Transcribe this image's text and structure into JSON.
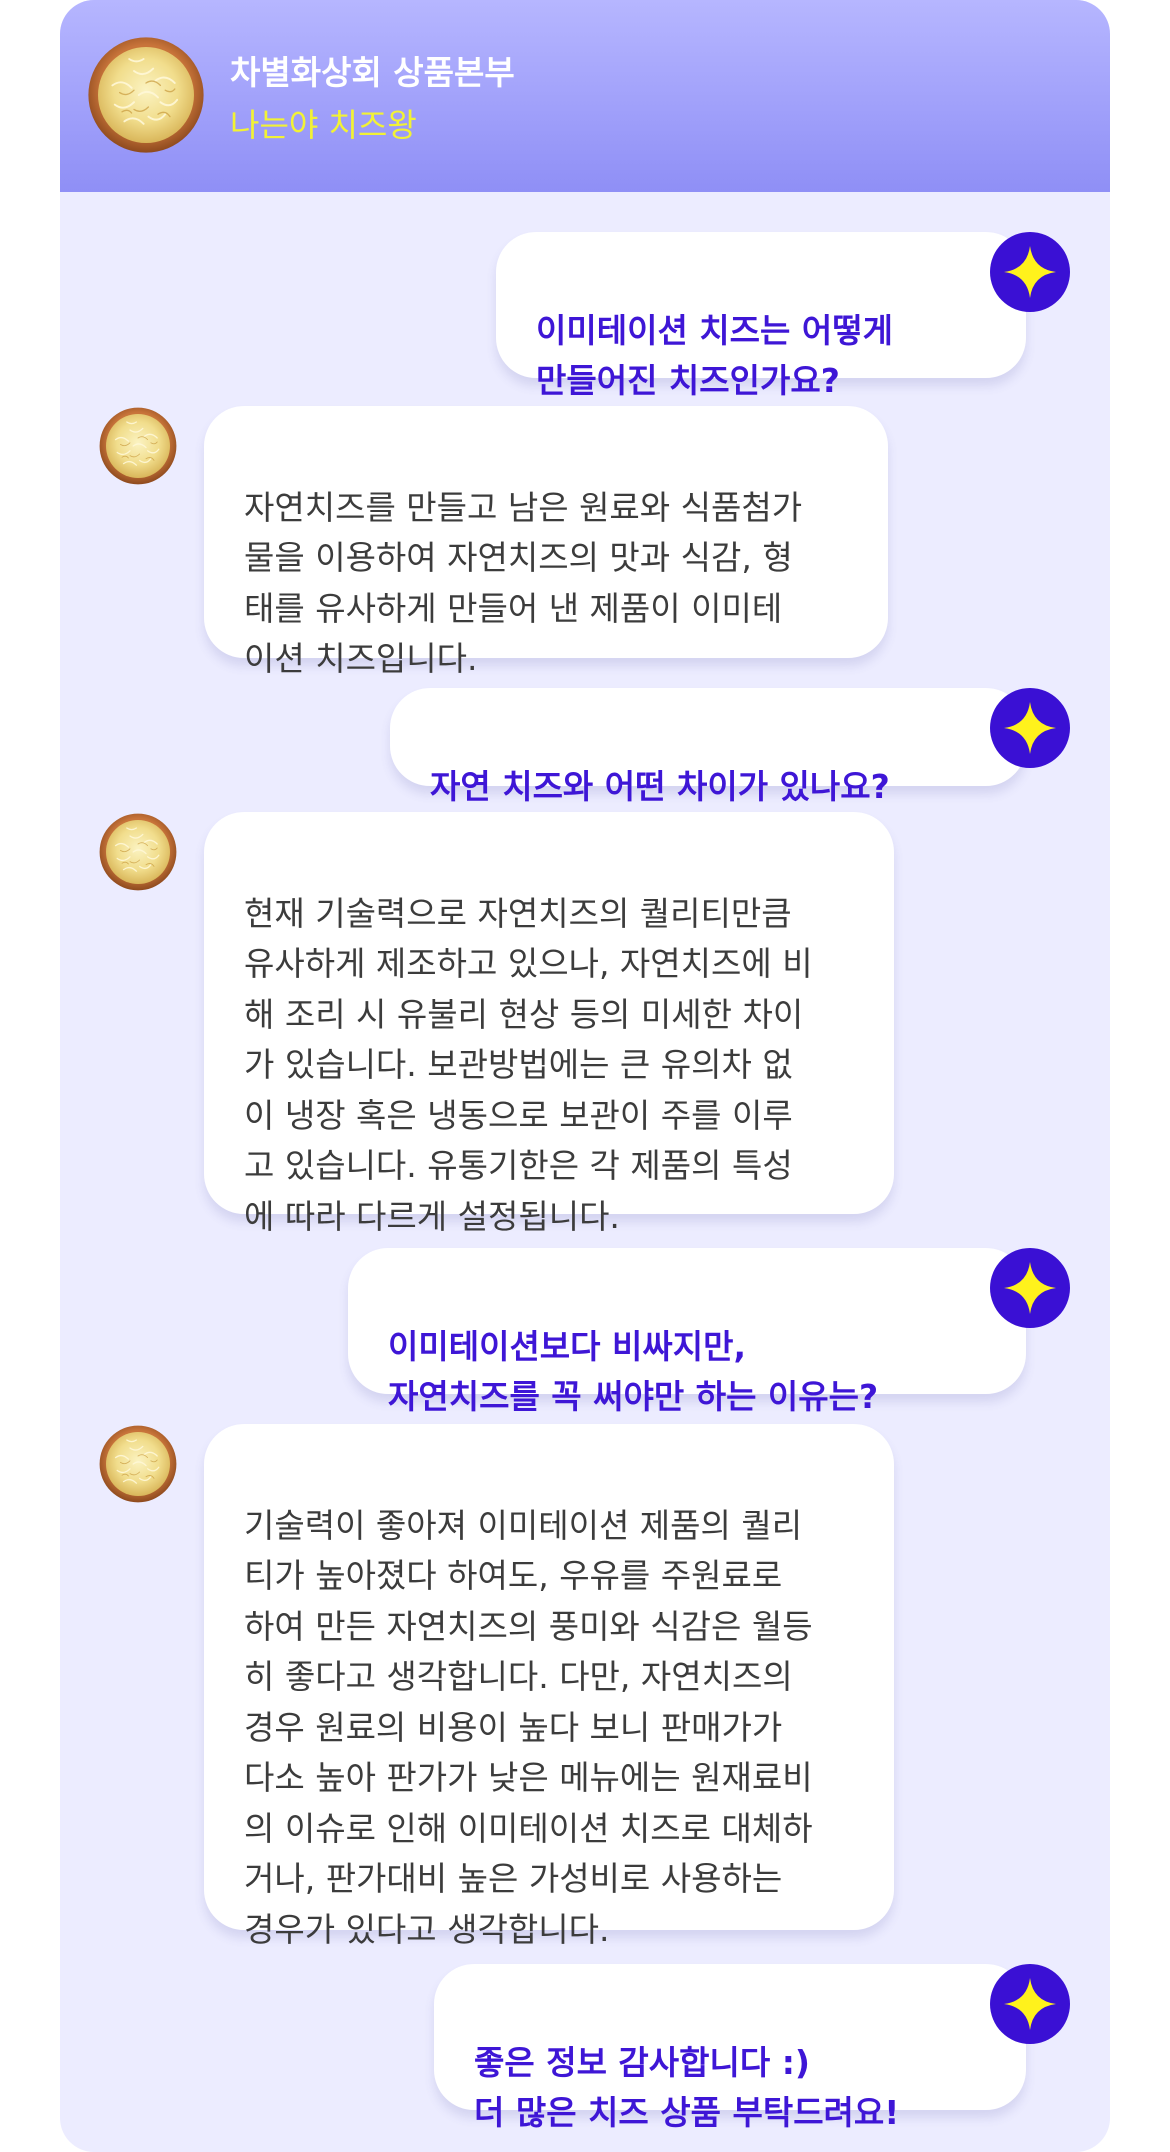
{
  "header": {
    "title": "차별화상회 상품본부",
    "subtitle": "나는야 치즈왕",
    "avatar_icon": "shredded-cheese-bowl-icon"
  },
  "colors": {
    "header_gradient_top": "#b6b6ff",
    "header_gradient_bottom": "#8f8ff6",
    "chat_background": "#ececff",
    "user_text": "#3e16d6",
    "bot_text": "#3c3c3c",
    "subtitle_text": "#f2f235",
    "star_avatar_bg": "#3a10d4",
    "star_color": "#fff21c"
  },
  "messages": [
    {
      "sender": "user",
      "avatar_icon": "sparkle-star-icon",
      "text": "이미테이션 치즈는 어떻게\n만들어진 치즈인가요?"
    },
    {
      "sender": "bot",
      "avatar_icon": "shredded-cheese-bowl-icon",
      "text": "자연치즈를 만들고 남은 원료와 식품첨가\n물을 이용하여 자연치즈의 맛과 식감, 형\n태를 유사하게 만들어 낸 제품이 이미테\n이션 치즈입니다."
    },
    {
      "sender": "user",
      "avatar_icon": "sparkle-star-icon",
      "text": "자연 치즈와 어떤 차이가 있나요?"
    },
    {
      "sender": "bot",
      "avatar_icon": "shredded-cheese-bowl-icon",
      "text": "현재 기술력으로 자연치즈의 퀄리티만큼\n유사하게 제조하고 있으나, 자연치즈에 비\n해 조리 시 유불리 현상 등의 미세한 차이\n가 있습니다. 보관방법에는 큰 유의차 없\n이 냉장 혹은 냉동으로 보관이 주를 이루\n고 있습니다. 유통기한은 각 제품의 특성\n에 따라 다르게 설정됩니다."
    },
    {
      "sender": "user",
      "avatar_icon": "sparkle-star-icon",
      "text": "이미테이션보다 비싸지만,\n자연치즈를 꼭 써야만 하는 이유는?"
    },
    {
      "sender": "bot",
      "avatar_icon": "shredded-cheese-bowl-icon",
      "text": "기술력이 좋아져 이미테이션 제품의 퀄리\n티가 높아졌다 하여도, 우유를 주원료로\n하여 만든 자연치즈의 풍미와 식감은 월등\n히 좋다고 생각합니다. 다만, 자연치즈의\n경우 원료의 비용이 높다 보니 판매가가\n다소 높아 판가가 낮은 메뉴에는 원재료비\n의 이슈로 인해 이미테이션 치즈로 대체하\n거나, 판가대비 높은 가성비로 사용하는\n경우가 있다고 생각합니다."
    },
    {
      "sender": "user",
      "avatar_icon": "sparkle-star-icon",
      "text": "좋은 정보 감사합니다 :)\n더 많은 치즈 상품 부탁드려요!"
    }
  ]
}
